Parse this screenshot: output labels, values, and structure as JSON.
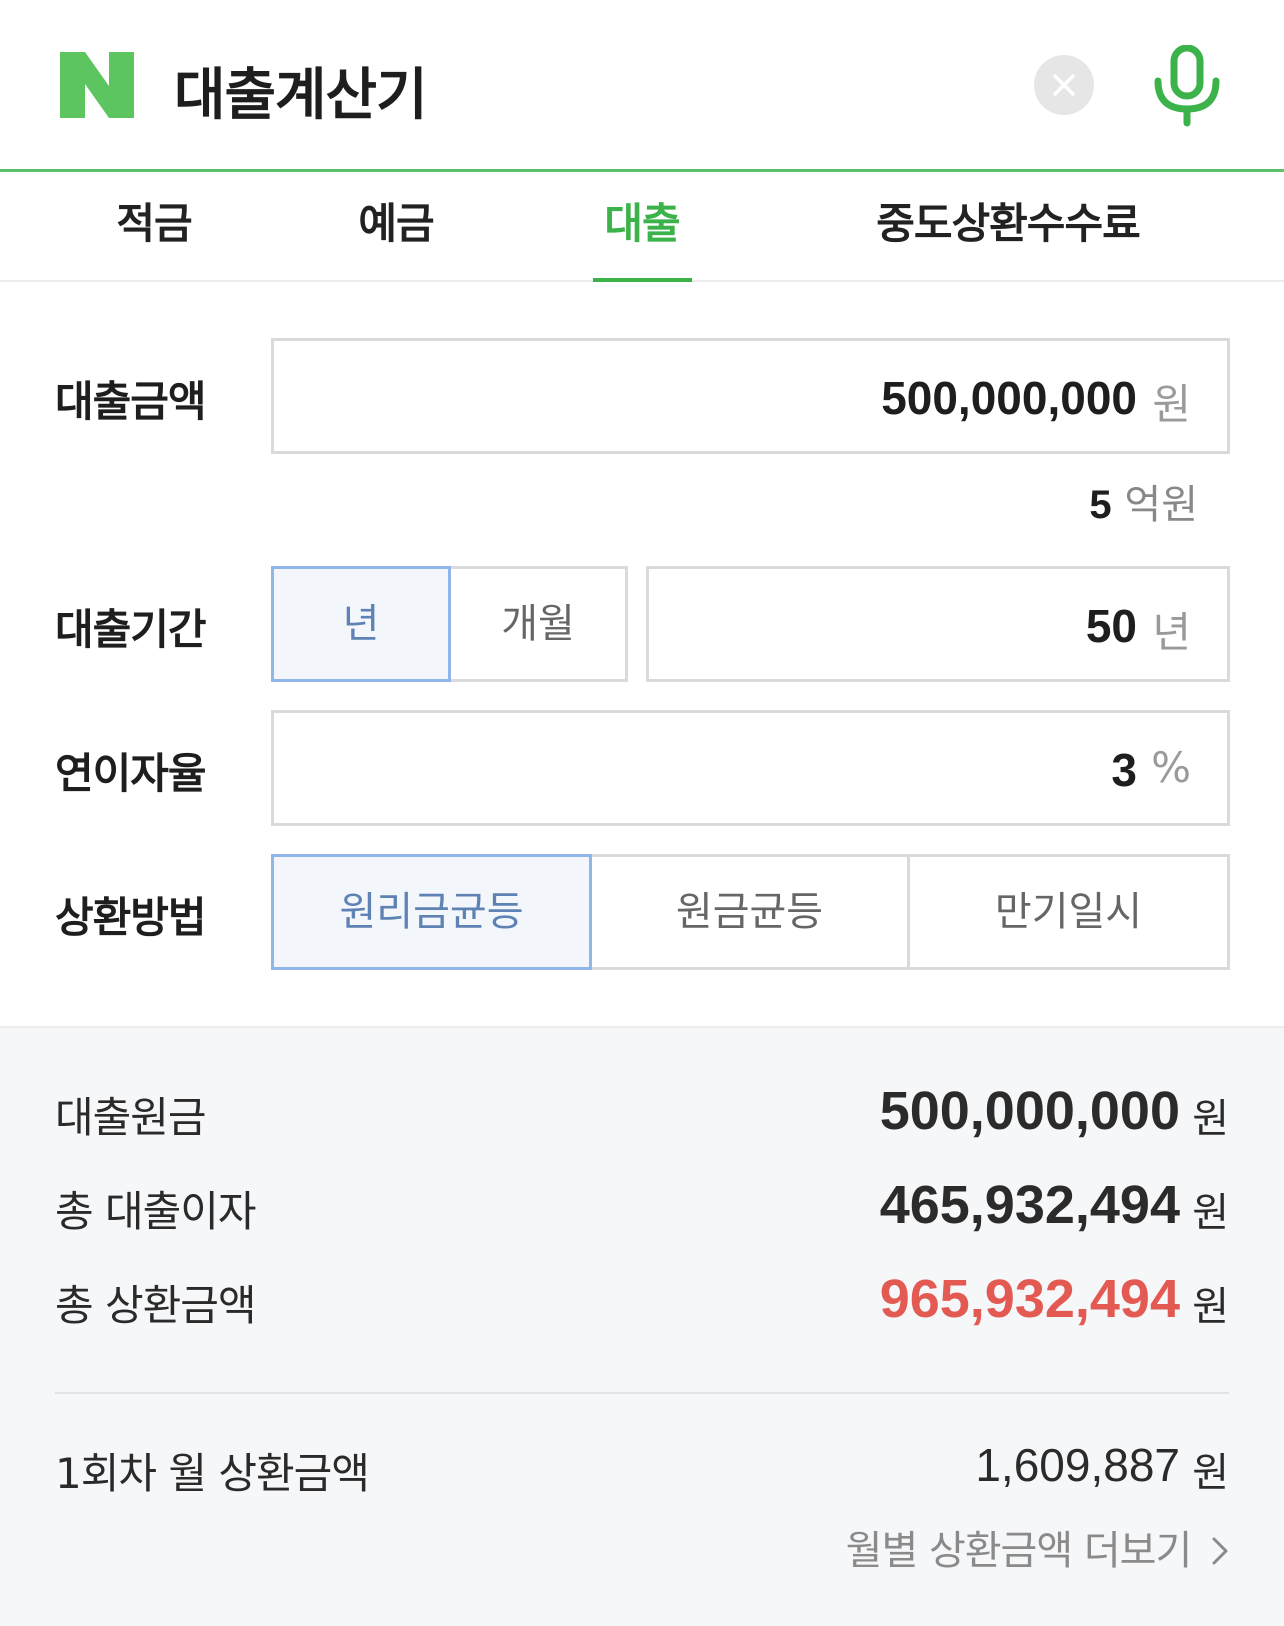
{
  "header": {
    "title": "대출계산기"
  },
  "tabs": [
    {
      "label": "적금"
    },
    {
      "label": "예금"
    },
    {
      "label": "대출"
    },
    {
      "label": "중도상환수수료"
    }
  ],
  "active_tab": "대출",
  "form": {
    "amount": {
      "label": "대출금액",
      "value": "500,000,000",
      "unit": "원",
      "hint_number": "5",
      "hint_unit": "억원"
    },
    "period": {
      "label": "대출기간",
      "option_year": "년",
      "option_month": "개월",
      "selected": "년",
      "value": "50",
      "unit": "년"
    },
    "rate": {
      "label": "연이자율",
      "value": "3",
      "unit": "%"
    },
    "method": {
      "label": "상환방법",
      "options": [
        "원리금균등",
        "원금균등",
        "만기일시"
      ],
      "selected": "원리금균등"
    }
  },
  "results": {
    "principal": {
      "label": "대출원금",
      "amount": "500,000,000",
      "unit": "원"
    },
    "interest": {
      "label": "총 대출이자",
      "amount": "465,932,494",
      "unit": "원"
    },
    "total": {
      "label": "총 상환금액",
      "amount": "965,932,494",
      "unit": "원"
    },
    "first_payment": {
      "label": "1회차 월 상환금액",
      "amount": "1,609,887",
      "unit": "원"
    },
    "more_link": "월별 상환금액 더보기"
  },
  "colors": {
    "brand_green": "#3cb24a",
    "highlight_red": "#e35a52",
    "selected_blue": "#5f82b4"
  }
}
